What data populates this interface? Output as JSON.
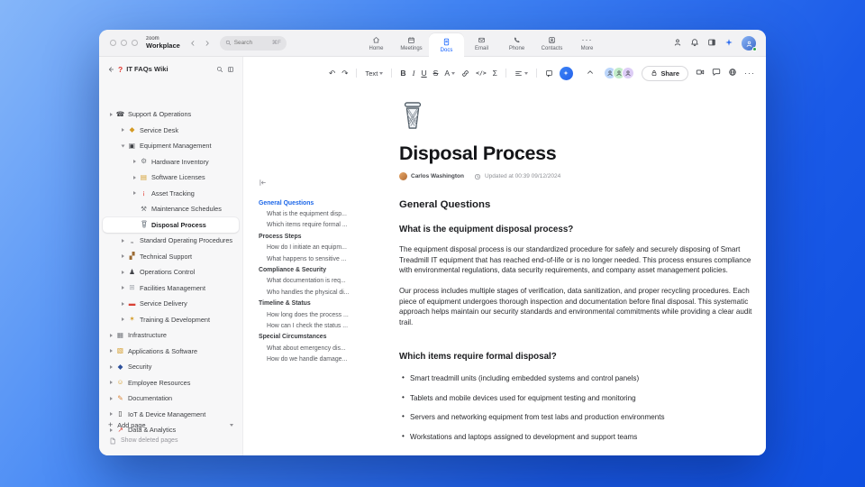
{
  "colors": {
    "accent": "#0b5cff",
    "outline_active": "#1b66e8",
    "window_bg": "#ffffff",
    "sidebar_bg": "#f7f7f8",
    "background_gradient": [
      "#85b6f9",
      "#1a5ae8"
    ]
  },
  "titlebar": {
    "logo_top": "zoom",
    "logo_bottom": "Workplace",
    "search_placeholder": "Search",
    "search_shortcut": "⌘F",
    "tabs": [
      {
        "label": "Home"
      },
      {
        "label": "Meetings"
      },
      {
        "label": "Docs"
      },
      {
        "label": "Email"
      },
      {
        "label": "Phone"
      },
      {
        "label": "Contacts"
      },
      {
        "label": "More",
        "glyph": "···"
      }
    ]
  },
  "sidebar": {
    "title": "IT FAQs Wiki",
    "title_icon": "?",
    "items": [
      {
        "icon": "☎",
        "label": "Support & Operations",
        "level": 0,
        "chevron": "right"
      },
      {
        "icon": "◆",
        "label": "Service Desk",
        "level": 1,
        "chevron": "right"
      },
      {
        "icon": "▣",
        "label": "Equipment Management",
        "level": 1,
        "chevron": "down"
      },
      {
        "icon": "⚙",
        "label": "Hardware Inventory",
        "level": 2,
        "chevron": "right"
      },
      {
        "icon": "▤",
        "label": "Software Licenses",
        "level": 2,
        "chevron": "right"
      },
      {
        "icon": "¡",
        "label": "Asset Tracking",
        "level": 2,
        "chevron": "right"
      },
      {
        "icon": "⚒",
        "label": "Maintenance Schedules",
        "level": 2,
        "chevron": "none"
      },
      {
        "icon": "",
        "label": "Disposal Process",
        "level": 2,
        "chevron": "none",
        "selected": true
      },
      {
        "icon": "„",
        "label": "Standard Operating Procedures",
        "level": 1,
        "chevron": "right"
      },
      {
        "icon": "▞",
        "label": "Technical Support",
        "level": 1,
        "chevron": "right"
      },
      {
        "icon": "♟",
        "label": "Operations Control",
        "level": 1,
        "chevron": "right"
      },
      {
        "icon": "⊞",
        "label": "Facilities Management",
        "level": 1,
        "chevron": "right"
      },
      {
        "icon": "▬",
        "label": "Service Delivery",
        "level": 1,
        "chevron": "right"
      },
      {
        "icon": "✶",
        "label": "Training & Development",
        "level": 1,
        "chevron": "right"
      },
      {
        "icon": "▦",
        "label": "Infrastructure",
        "level": 0,
        "chevron": "right"
      },
      {
        "icon": "▧",
        "label": "Applications & Software",
        "level": 0,
        "chevron": "right"
      },
      {
        "icon": "◆",
        "label": "Security",
        "level": 0,
        "chevron": "right"
      },
      {
        "icon": "☺",
        "label": "Employee Resources",
        "level": 0,
        "chevron": "right"
      },
      {
        "icon": "✎",
        "label": "Documentation",
        "level": 0,
        "chevron": "right"
      },
      {
        "icon": "▯",
        "label": "IoT & Device Management",
        "level": 0,
        "chevron": "right"
      },
      {
        "icon": "↗",
        "label": "Data & Analytics",
        "level": 0,
        "chevron": "right"
      }
    ],
    "add_page": "Add page",
    "add_glyph": "+",
    "show_deleted": "Show deleted pages"
  },
  "outline": {
    "items": [
      {
        "label": "General Questions",
        "type": "header",
        "active": true
      },
      {
        "label": "What is the equipment disp...",
        "type": "sub"
      },
      {
        "label": "Which items require formal ...",
        "type": "sub"
      },
      {
        "label": "Process Steps",
        "type": "header"
      },
      {
        "label": "How do I initiate an equipm...",
        "type": "sub"
      },
      {
        "label": "What happens to sensitive ...",
        "type": "sub"
      },
      {
        "label": "Compliance & Security",
        "type": "header"
      },
      {
        "label": "What documentation is req...",
        "type": "sub"
      },
      {
        "label": "Who handles the physical di...",
        "type": "sub"
      },
      {
        "label": "Timeline & Status",
        "type": "header"
      },
      {
        "label": "How long does the process ...",
        "type": "sub"
      },
      {
        "label": "How can I check the status ...",
        "type": "sub"
      },
      {
        "label": "Special Circumstances",
        "type": "header"
      },
      {
        "label": "What about emergency dis...",
        "type": "sub"
      },
      {
        "label": "How do we handle damage...",
        "type": "sub"
      }
    ]
  },
  "toolbar": {
    "undo": "↶",
    "redo": "↷",
    "text_dropdown": "Text",
    "bold": "B",
    "italic": "I",
    "underline": "U",
    "strike": "S",
    "color": "A",
    "code": "</>",
    "formula": "Σ",
    "share_label": "Share",
    "more_glyph": "···"
  },
  "doc": {
    "title": "Disposal Process",
    "author": "Carlos Washington",
    "updated": "Updated at 00:39 09/12/2024",
    "h2": "General Questions",
    "q1": "What is the equipment disposal process?",
    "p1": "The equipment disposal process is our standardized procedure for safely and securely disposing of Smart Treadmill IT equipment that has reached end-of-life or is no longer needed. This process ensures compliance with environmental regulations, data security requirements, and company asset management policies.",
    "p2": "Our process includes multiple stages of verification, data sanitization, and proper recycling procedures. Each piece of equipment undergoes thorough inspection and documentation before final disposal. This systematic approach helps maintain our security standards and environmental commitments while providing a clear audit trail.",
    "q2": "Which items require formal disposal?",
    "bullets": [
      "Smart treadmill units (including embedded systems and control panels)",
      "Tablets and mobile devices used for equipment testing and monitoring",
      "Servers and networking equipment from test labs and production environments",
      "Workstations and laptops assigned to development and support teams"
    ]
  }
}
